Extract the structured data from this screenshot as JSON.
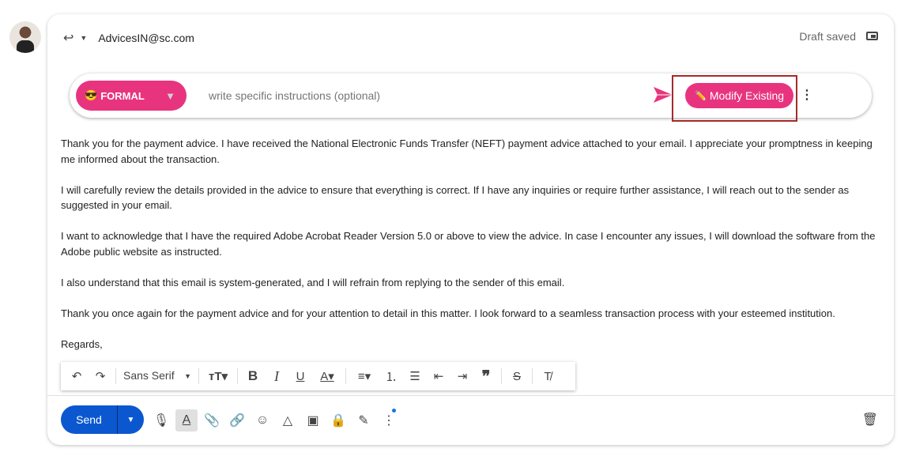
{
  "header": {
    "from": "AdvicesIN@sc.com",
    "status": "Draft saved"
  },
  "ai_bar": {
    "tone_emoji": "😎",
    "tone": "FORMAL",
    "tone_arrow": "▼",
    "placeholder": "write specific instructions (optional)",
    "modify_emoji": "✏️",
    "modify_label": "Modify Existing",
    "accent": "#e8347f"
  },
  "body": {
    "paragraphs": [
      "Thank you for the payment advice. I have received the National Electronic Funds Transfer (NEFT) payment advice attached to your email. I appreciate your promptness in keeping me informed about the transaction.",
      "I will carefully review the details provided in the advice to ensure that everything is correct. If I have any inquiries or require further assistance, I will reach out to the sender as suggested in your email.",
      "I want to acknowledge that I have the required Adobe Acrobat Reader Version 5.0 or above to view the advice. In case I encounter any issues, I will download the software from the Adobe public website as instructed.",
      "I also understand that this email is system-generated, and I will refrain from replying to the sender of this email.",
      "Thank you once again for the payment advice and for your attention to detail in this matter. I look forward to a seamless transaction process with your esteemed institution.",
      "Regards,"
    ]
  },
  "format_bar": {
    "font": "Sans Serif"
  },
  "footer": {
    "send_label": "Send",
    "send_color": "#0b57d0"
  }
}
